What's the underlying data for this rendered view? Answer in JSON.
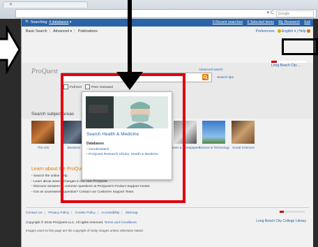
{
  "browser": {
    "search_placeholder": "Google"
  },
  "topbar": {
    "searching_prefix": "Searching:",
    "databases_link": "4 databases",
    "recent": "0 Recent searches",
    "selected": "0 Selected items",
    "research": "My Research",
    "exit": "Exit"
  },
  "subnav": {
    "basic": "Basic Search",
    "advanced": "Advanced",
    "publications": "Publications",
    "preferences": "Preferences",
    "language": "English",
    "help": "Help"
  },
  "search": {
    "logo": "ProQuest",
    "advanced_link": "Advanced search",
    "tips": "Search tips",
    "fulltext": "Full text",
    "peer": "Peer reviewed"
  },
  "library": {
    "name": "Long Beach City ...",
    "footer_name": "Long Beach City College Library"
  },
  "subjects": {
    "heading": "Search subject areas",
    "tiles": [
      {
        "label": "The Arts",
        "color": "#b05a2a"
      },
      {
        "label": "Business",
        "color": "#3a4a60"
      },
      {
        "label": "News & Newspapers",
        "color": "#5a5a5a"
      },
      {
        "label": "Science & Technology",
        "color": "#4a88c8"
      },
      {
        "label": "Social Sciences",
        "color": "#a07040"
      }
    ]
  },
  "learn": {
    "heading": "Learn about the ProQuest",
    "items": [
      "Search the online Help.",
      "Learn about search changes in the new ProQuest.",
      "Discover answers to common questions at ProQuest's Product Support Center.",
      "Got an unanswered question? Contact our Customer Support Team."
    ]
  },
  "footer": {
    "links": [
      "Contact Us",
      "Privacy Policy",
      "Cookie Policy",
      "Accessibility",
      "Sitemap"
    ],
    "copyright": "Copyright © 2015 ProQuest LLC. All rights reserved.",
    "terms": "Terms and Conditions",
    "images": "Images used on this page are the copyright of Getty Images unless otherwise stated."
  },
  "popup": {
    "title": "Search Health & Medicine",
    "db_heading": "Databases",
    "databases": [
      "GenderWatch",
      "ProQuest Research Library: Health & Medicine"
    ]
  }
}
